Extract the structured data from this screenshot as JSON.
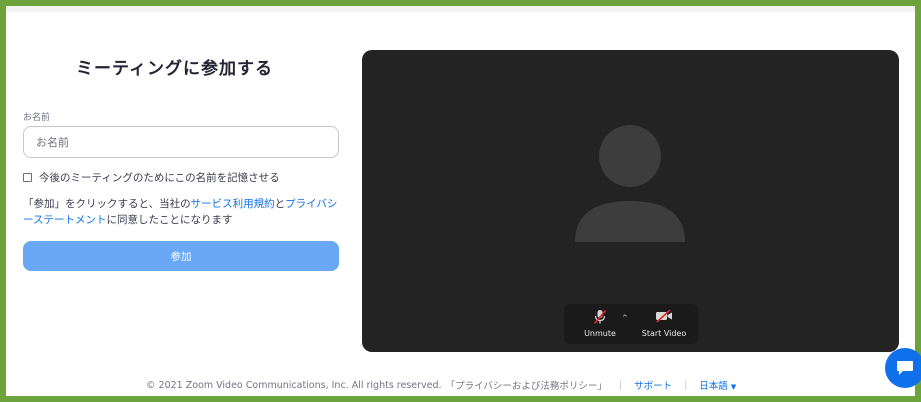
{
  "page": {
    "title": "ミーティングに参加する"
  },
  "form": {
    "name_label": "お名前",
    "name_placeholder": "お名前",
    "name_value": "",
    "remember_label": "今後のミーティングのためにこの名前を記憶させる",
    "remember_checked": false,
    "terms_prefix": "「参加」をクリックすると、当社の",
    "terms_link_1": "サービス利用規約",
    "terms_middle": "と",
    "terms_link_2": "プライバシーステートメント",
    "terms_suffix": "に同意したことになります",
    "join_label": "参加"
  },
  "video": {
    "unmute_label": "Unmute",
    "start_video_label": "Start Video",
    "muted": true,
    "video_off": true
  },
  "footer": {
    "copyright": "© 2021 Zoom Video Communications, Inc. All rights reserved.",
    "privacy": "「プライバシーおよび法務ポリシー」",
    "support": "サポート",
    "language": "日本語"
  },
  "colors": {
    "frame_border": "#6ca33d",
    "accent": "#0e71eb",
    "join_button": "#6aa8f5",
    "video_bg": "#232323"
  },
  "icons": {
    "mic": "mic-muted-icon",
    "camera": "video-off-icon",
    "chat": "chat-icon"
  }
}
